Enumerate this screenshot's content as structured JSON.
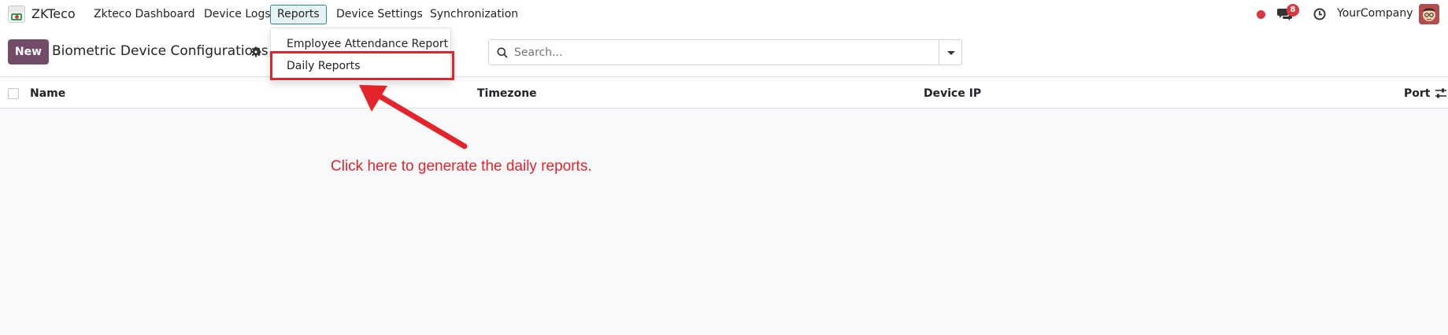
{
  "app": {
    "name": "ZKTeco"
  },
  "nav": {
    "items": [
      {
        "label": "Zkteco Dashboard"
      },
      {
        "label": "Device Logs"
      },
      {
        "label": "Reports"
      },
      {
        "label": "Device Settings"
      },
      {
        "label": "Synchronization"
      }
    ],
    "active": "Reports"
  },
  "systray": {
    "chat_count": "8",
    "company": "YourCompany"
  },
  "control": {
    "new_label": "New",
    "title": "Biometric Device Configurations",
    "search_placeholder": "Search..."
  },
  "reports_menu": {
    "items": [
      {
        "label": "Employee Attendance Report"
      },
      {
        "label": "Daily Reports"
      }
    ]
  },
  "table": {
    "columns": [
      "Name",
      "Timezone",
      "Device IP",
      "Port"
    ]
  },
  "annotation": {
    "text": "Click here to generate the daily reports.",
    "color": "#e3242b"
  },
  "colors": {
    "brand": "#714b67",
    "active_nav": "#2a8a8f",
    "badge": "#d9363e"
  },
  "icons": [
    "app-logo-icon",
    "record-icon",
    "chat-icon",
    "clock-icon",
    "avatar-icon",
    "gear-icon",
    "search-icon",
    "caret-down-icon",
    "column-settings-icon",
    "arrow-icon"
  ]
}
